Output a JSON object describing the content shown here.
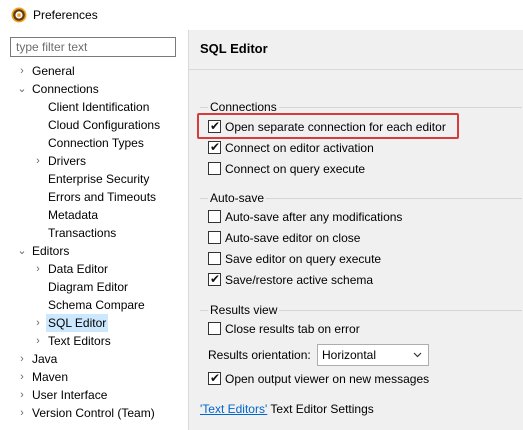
{
  "window": {
    "title": "Preferences",
    "icon": "eclipse-gear-icon"
  },
  "filter": {
    "placeholder": "type filter text",
    "value": ""
  },
  "tree": {
    "items": [
      {
        "label": "General",
        "expander": "collapsed"
      },
      {
        "label": "Connections",
        "expander": "expanded"
      },
      {
        "label": "Client Identification",
        "expander": "none"
      },
      {
        "label": "Cloud Configurations",
        "expander": "none"
      },
      {
        "label": "Connection Types",
        "expander": "none"
      },
      {
        "label": "Drivers",
        "expander": "collapsed"
      },
      {
        "label": "Enterprise Security",
        "expander": "none"
      },
      {
        "label": "Errors and Timeouts",
        "expander": "none"
      },
      {
        "label": "Metadata",
        "expander": "none"
      },
      {
        "label": "Transactions",
        "expander": "none"
      },
      {
        "label": "Editors",
        "expander": "expanded"
      },
      {
        "label": "Data Editor",
        "expander": "collapsed"
      },
      {
        "label": "Diagram Editor",
        "expander": "none"
      },
      {
        "label": "Schema Compare",
        "expander": "none"
      },
      {
        "label": "SQL Editor",
        "expander": "collapsed",
        "selected": true
      },
      {
        "label": "Text Editors",
        "expander": "collapsed"
      },
      {
        "label": "Java",
        "expander": "collapsed"
      },
      {
        "label": "Maven",
        "expander": "collapsed"
      },
      {
        "label": "User Interface",
        "expander": "collapsed"
      },
      {
        "label": "Version Control (Team)",
        "expander": "collapsed"
      }
    ]
  },
  "page": {
    "title": "SQL Editor",
    "connections": {
      "label": "Connections",
      "options": [
        {
          "label": "Open separate connection for each editor",
          "checked": true,
          "highlighted": true
        },
        {
          "label": "Connect on editor activation",
          "checked": true
        },
        {
          "label": "Connect on query execute",
          "checked": false
        }
      ]
    },
    "autosave": {
      "label": "Auto-save",
      "options": [
        {
          "label": "Auto-save after any modifications",
          "checked": false
        },
        {
          "label": "Auto-save editor on close",
          "checked": false
        },
        {
          "label": "Save editor on query execute",
          "checked": false
        },
        {
          "label": "Save/restore active schema",
          "checked": true
        }
      ]
    },
    "results": {
      "label": "Results view",
      "close_on_error": {
        "label": "Close results tab on error",
        "checked": false
      },
      "orientation_label": "Results orientation:",
      "orientation_value": "Horizontal",
      "open_output": {
        "label": "Open output viewer on new messages",
        "checked": true
      }
    },
    "footer": {
      "link": "'Text Editors'",
      "suffix": " Text Editor Settings"
    }
  },
  "colors": {
    "highlight": "#d83b3b",
    "selection": "#cce8ff",
    "link": "#0066cc",
    "panel_bg": "#f0f0f0"
  }
}
